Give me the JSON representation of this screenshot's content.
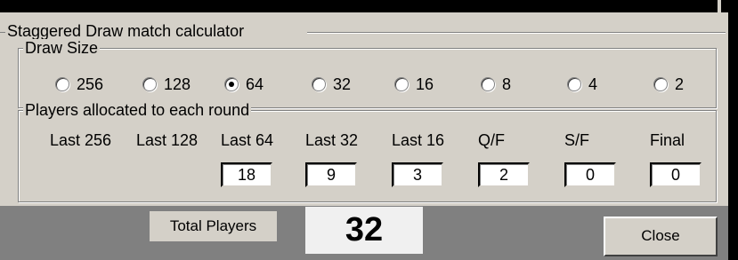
{
  "window": {
    "title": "Staggered Draw match calculator"
  },
  "draw_size": {
    "label": "Draw Size",
    "options": [
      "256",
      "128",
      "64",
      "32",
      "16",
      "8",
      "4",
      "2"
    ],
    "selected": "64"
  },
  "players": {
    "label": "Players allocated to each round",
    "rounds": [
      {
        "label": "Last 256",
        "value": null
      },
      {
        "label": "Last 128",
        "value": null
      },
      {
        "label": "Last 64",
        "value": "18"
      },
      {
        "label": "Last 32",
        "value": "9"
      },
      {
        "label": "Last 16",
        "value": "3"
      },
      {
        "label": "Q/F",
        "value": "2"
      },
      {
        "label": "S/F",
        "value": "0"
      },
      {
        "label": "Final",
        "value": "0"
      }
    ]
  },
  "total": {
    "label": "Total Players",
    "value": "32"
  },
  "buttons": {
    "close": "Close"
  },
  "colors": {
    "panel": "#d4d0c8",
    "background": "#404040",
    "bottom": "#808080"
  }
}
